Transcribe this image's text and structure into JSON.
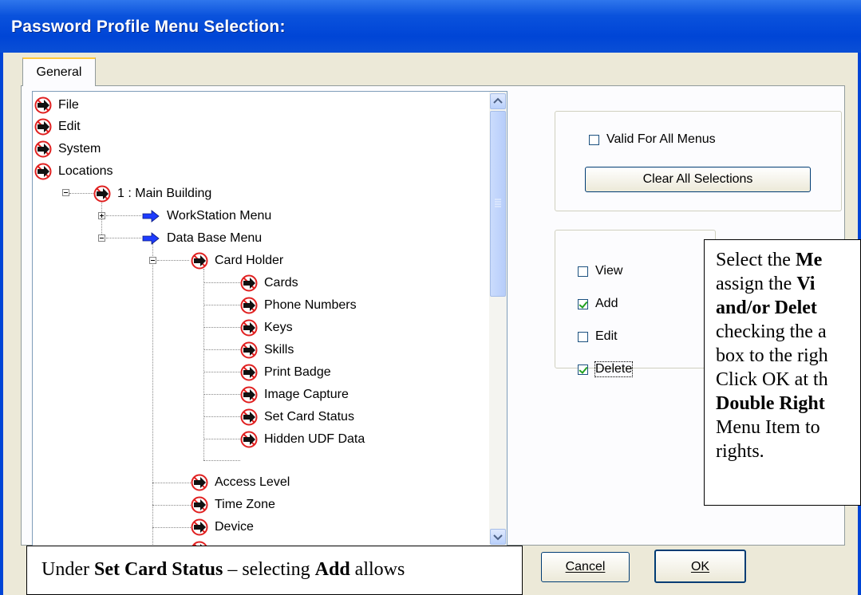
{
  "window": {
    "title": "Password Profile Menu Selection:"
  },
  "tabs": [
    {
      "label": "General"
    }
  ],
  "tree": {
    "items": [
      {
        "label": "File",
        "icon": "no-entry-arrow-icon"
      },
      {
        "label": "Edit",
        "icon": "no-entry-arrow-icon"
      },
      {
        "label": "System",
        "icon": "no-entry-arrow-icon"
      },
      {
        "label": "Locations",
        "icon": "no-entry-arrow-icon"
      },
      {
        "label": "1 : Main Building",
        "icon": "no-entry-arrow-icon"
      },
      {
        "label": "WorkStation Menu",
        "icon": "blue-arrow-icon"
      },
      {
        "label": "Data Base Menu",
        "icon": "blue-arrow-icon"
      },
      {
        "label": "Card Holder",
        "icon": "no-entry-arrow-icon"
      },
      {
        "label": "Cards",
        "icon": "no-entry-arrow-icon"
      },
      {
        "label": "Phone Numbers",
        "icon": "no-entry-arrow-icon"
      },
      {
        "label": "Keys",
        "icon": "no-entry-arrow-icon"
      },
      {
        "label": "Skills",
        "icon": "no-entry-arrow-icon"
      },
      {
        "label": "Print Badge",
        "icon": "no-entry-arrow-icon"
      },
      {
        "label": "Image Capture",
        "icon": "no-entry-arrow-icon"
      },
      {
        "label": "Set Card Status",
        "icon": "no-entry-arrow-icon"
      },
      {
        "label": "Hidden UDF Data",
        "icon": "no-entry-arrow-icon"
      },
      {
        "label": "Access Level",
        "icon": "no-entry-arrow-icon"
      },
      {
        "label": "Time Zone",
        "icon": "no-entry-arrow-icon"
      },
      {
        "label": "Device",
        "icon": "no-entry-arrow-icon"
      }
    ]
  },
  "options": {
    "valid_for_all_label": "Valid For All Menus",
    "valid_for_all_checked": false,
    "clear_all_label": "Clear All Selections"
  },
  "rights": [
    {
      "label": "View",
      "checked": false
    },
    {
      "label": "Add",
      "checked": true
    },
    {
      "label": "Edit",
      "checked": false
    },
    {
      "label": "Delete",
      "checked": true
    }
  ],
  "buttons": {
    "cancel": "Cancel",
    "ok": "OK"
  },
  "callouts": {
    "right": {
      "l1a": "Select the ",
      "l1b": "Me",
      "l2a": "assign the ",
      "l2b": "Vi",
      "l3": "and/or Delet",
      "l4": "checking the a",
      "l5": "box to the righ",
      "l6": "Click OK at th",
      "l7": "Double Right",
      "l8": "Menu Item to",
      "l9": "rights."
    },
    "bottom": {
      "a": "Under ",
      "b": "Set Card Status",
      "c": " – selecting ",
      "d": "Add",
      "e": " allows"
    }
  },
  "colors": {
    "titlebar": "#0045d6",
    "window_bg": "#ece9d8",
    "no_entry_red": "#e02020",
    "arrow_blue": "#1e3cff"
  }
}
